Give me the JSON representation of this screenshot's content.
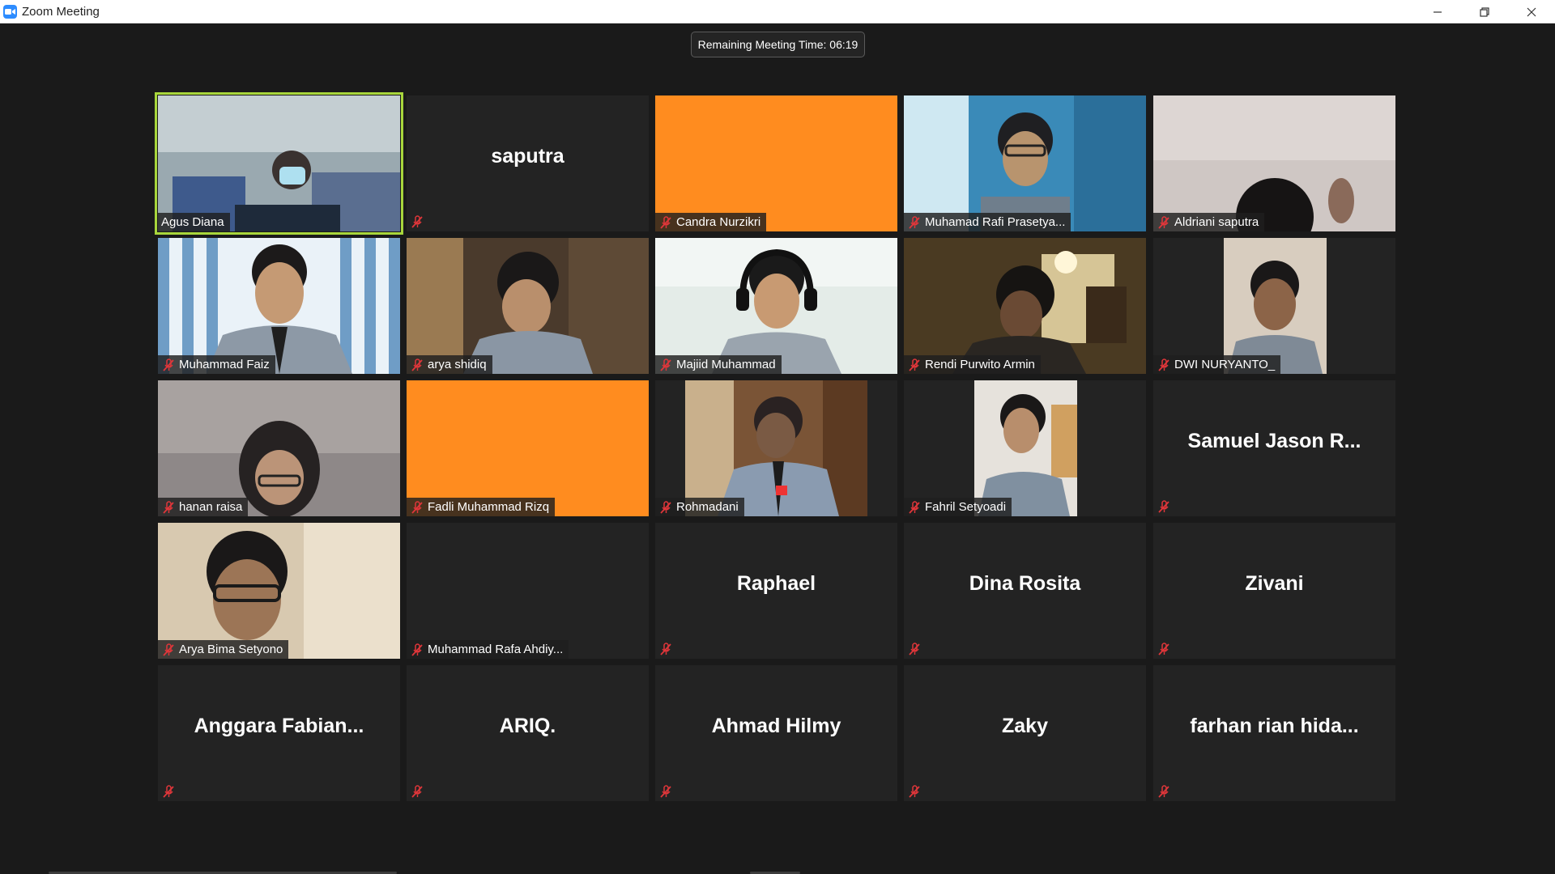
{
  "window": {
    "title": "Zoom Meeting"
  },
  "meeting": {
    "timer_text": "Remaining Meeting Time: 06:19"
  },
  "icons": {
    "app": "zoom-camera-icon",
    "minimize": "minimize-icon",
    "restore": "restore-icon",
    "close": "close-icon",
    "muted": "muted-microphone-icon"
  },
  "colors": {
    "background": "#1a1a1a",
    "tile": "#232323",
    "orange_tile": "#ff8c1f",
    "active_speaker_border": "#a8d63c",
    "muted_icon": "#e0363a",
    "zoom_blue": "#2d8cff"
  },
  "participants": [
    {
      "name": "Agus Diana",
      "muted": false,
      "active": true,
      "video": true
    },
    {
      "name": "saputra",
      "muted": true,
      "display_name": "saputra"
    },
    {
      "name": "Candra Nurzikri",
      "muted": true,
      "orange": true
    },
    {
      "name": "Muhamad Rafi Prasetya...",
      "muted": true,
      "video": true
    },
    {
      "name": "Aldriani saputra",
      "muted": true,
      "video": true
    },
    {
      "name": "Muhammad Faiz",
      "muted": true,
      "video": true
    },
    {
      "name": "arya shidiq",
      "muted": true,
      "video": true
    },
    {
      "name": "Majiid Muhammad",
      "muted": true,
      "video": true
    },
    {
      "name": "Rendi Purwito Armin",
      "muted": true,
      "video": true
    },
    {
      "name": "DWI NURYANTO_",
      "muted": true,
      "video": true
    },
    {
      "name": "hanan raisa",
      "muted": true,
      "video": true
    },
    {
      "name": "Fadli Muhammad Rizq",
      "muted": true,
      "orange": true
    },
    {
      "name": "Rohmadani",
      "muted": true,
      "video": true
    },
    {
      "name": "Fahril Setyoadi",
      "muted": true,
      "video": true
    },
    {
      "name": "",
      "muted": true,
      "display_name": "Samuel Jason R..."
    },
    {
      "name": "Arya Bima Setyono",
      "muted": true,
      "video": true
    },
    {
      "name": "Muhammad Rafa Ahdiy...",
      "muted": true
    },
    {
      "name": "",
      "muted": true,
      "display_name": "Raphael"
    },
    {
      "name": "",
      "muted": true,
      "display_name": "Dina Rosita"
    },
    {
      "name": "",
      "muted": true,
      "display_name": "Zivani"
    },
    {
      "name": "",
      "muted": true,
      "display_name": "Anggara  Fabian..."
    },
    {
      "name": "",
      "muted": true,
      "display_name": "ARIQ."
    },
    {
      "name": "",
      "muted": true,
      "display_name": "Ahmad Hilmy"
    },
    {
      "name": "",
      "muted": true,
      "display_name": "Zaky"
    },
    {
      "name": "",
      "muted": true,
      "display_name": "farhan rian hida..."
    }
  ]
}
